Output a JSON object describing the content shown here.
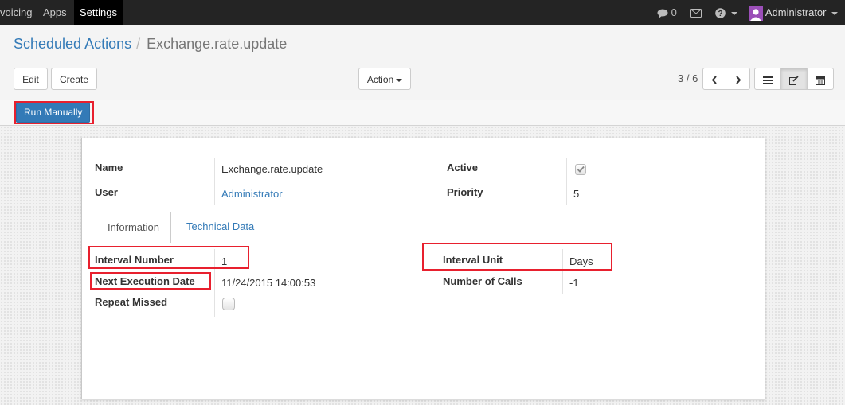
{
  "topbar": {
    "menu": [
      "voicing",
      "Apps",
      "Settings"
    ],
    "messages_count": "0",
    "user_name": "Administrator"
  },
  "breadcrumb": {
    "parent": "Scheduled Actions",
    "separator": "/",
    "current": "Exchange.rate.update"
  },
  "buttons": {
    "edit": "Edit",
    "create": "Create",
    "action": "Action"
  },
  "pager": {
    "value": "3 / 6"
  },
  "statusbar": {
    "run_manually": "Run Manually"
  },
  "form": {
    "name_label": "Name",
    "name_value": "Exchange.rate.update",
    "user_label": "User",
    "user_value": "Administrator",
    "active_label": "Active",
    "active_checked": true,
    "priority_label": "Priority",
    "priority_value": "5"
  },
  "tabs": [
    "Information",
    "Technical Data"
  ],
  "information": {
    "interval_number_label": "Interval Number",
    "interval_number_value": "1",
    "next_execution_label": "Next Execution Date",
    "next_execution_value": "11/24/2015 14:00:53",
    "repeat_missed_label": "Repeat Missed",
    "repeat_missed_checked": false,
    "interval_unit_label": "Interval Unit",
    "interval_unit_value": "Days",
    "number_of_calls_label": "Number of Calls",
    "number_of_calls_value": "-1"
  },
  "colors": {
    "topbar": "#242424",
    "link": "#337ab7",
    "primary_button": "#337ab7",
    "annotation": "#e8202e"
  }
}
